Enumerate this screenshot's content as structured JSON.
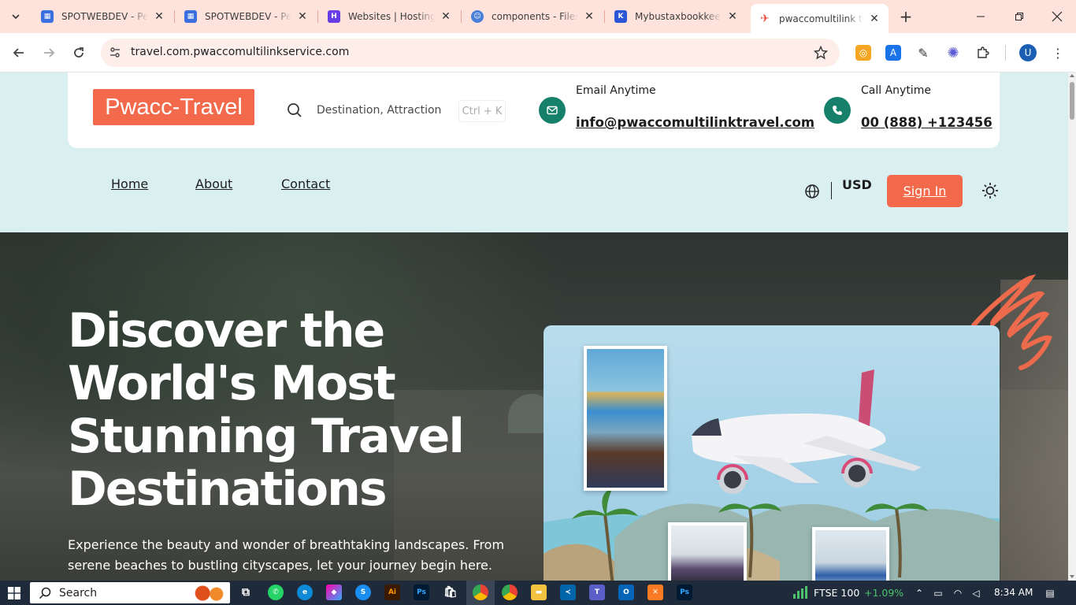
{
  "browser": {
    "tabs": [
      {
        "title": "SPOTWEBDEV - Personal",
        "favicon": "squares-blue-icon",
        "color": "#3b6fe0"
      },
      {
        "title": "SPOTWEBDEV - Personal",
        "favicon": "squares-blue-icon",
        "color": "#3b6fe0"
      },
      {
        "title": "Websites | Hostinger",
        "favicon": "hostinger-icon",
        "color": "#673de6"
      },
      {
        "title": "components - Files -",
        "favicon": "globe-face-icon",
        "color": "#4a7fd9"
      },
      {
        "title": "Mybustaxbookkeeping",
        "favicon": "k-logo-icon",
        "color": "#2a55d6"
      },
      {
        "title": "pwaccomultilink travel",
        "favicon": "plane-red-icon",
        "color": "#e94b3c"
      }
    ],
    "url": "travel.com.pwaccomultilinkservice.com"
  },
  "site": {
    "logo": "Pwacc-Travel",
    "search_placeholder": "Destination, Attraction",
    "shortcut": "Ctrl + K",
    "email_label": "Email Anytime",
    "email": "info@pwaccomultilinktravel.com",
    "call_label": "Call Anytime",
    "phone": "00 (888) +123456",
    "nav": [
      "Home",
      "About",
      "Contact"
    ],
    "currency": "USD",
    "signin": "Sign In",
    "accent": "#f26a4b",
    "brand_green": "#17806b"
  },
  "hero": {
    "title": "Discover the World's Most Stunning Travel Destinations",
    "description": "Experience the beauty and wonder of breathtaking landscapes. From serene beaches to bustling cityscapes, let your journey begin here."
  },
  "taskbar": {
    "search": "Search",
    "ticker": "FTSE 100",
    "ticker_change": "+1.09%",
    "time": "8:34 AM"
  }
}
